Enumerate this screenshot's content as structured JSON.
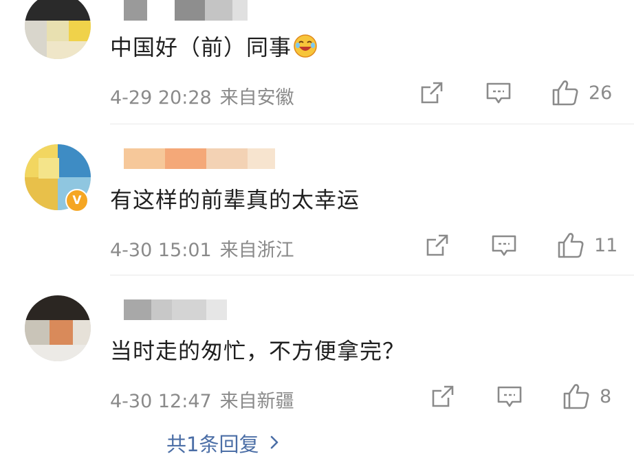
{
  "comments": [
    {
      "text": "中国好（前）同事",
      "date": "4-29 20:28",
      "location": "来自安徽",
      "likes": "26",
      "emoji_icon": "laughing-tears-emoji"
    },
    {
      "text": "有这样的前辈真的太幸运",
      "date": "4-30 15:01",
      "location": "来自浙江",
      "likes": "11",
      "badge": "V"
    },
    {
      "text": "当时走的匆忙，不方便拿完？",
      "date": "4-30 12:47",
      "location": "来自新疆",
      "likes": "8"
    }
  ],
  "reply_link": {
    "label": "共1条回复",
    "icon": "chevron-right-icon"
  },
  "icons": {
    "share": "share-icon",
    "comment": "comment-icon",
    "like": "like-icon"
  },
  "colors": {
    "text": "#1f1f1f",
    "meta": "#8a8a8a",
    "link": "#4b6ea6",
    "badge": "#f5a623",
    "divider": "#e8e8e8"
  }
}
